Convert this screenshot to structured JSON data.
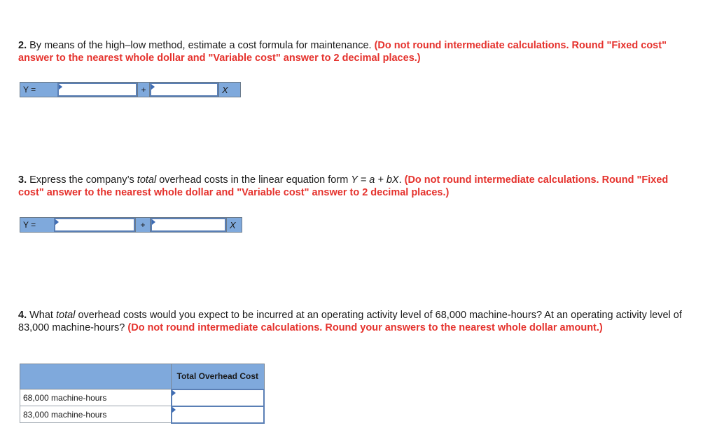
{
  "q2": {
    "number": "2.",
    "text": " By means of the high–low method, estimate a cost formula for maintenance. ",
    "instruction": "(Do not round intermediate calculations. Round \"Fixed cost\" answer to the nearest whole dollar and \"Variable cost\" answer to 2 decimal places.)",
    "equation": {
      "y_label": "Y =",
      "plus": "+",
      "x_label": "X",
      "fixed_value": "",
      "variable_value": ""
    }
  },
  "q3": {
    "number": "3.",
    "text_before": " Express the company’s ",
    "text_italic": "total",
    "text_after": " overhead costs in the linear equation form ",
    "formula": "Y = a + bX",
    "period": ". ",
    "instruction": "(Do not round intermediate calculations. Round \"Fixed cost\" answer to the nearest whole dollar and \"Variable cost\" answer to 2 decimal places.)",
    "equation": {
      "y_label": "Y =",
      "plus": "+",
      "x_label": "X",
      "fixed_value": "",
      "variable_value": ""
    }
  },
  "q4": {
    "number": "4.",
    "text_before": " What ",
    "text_italic": "total",
    "text_after": " overhead costs would you expect to be incurred at an operating activity level of 68,000 machine-hours? At an operating activity level of 83,000 machine-hours? ",
    "instruction": "(Do not round intermediate calculations. Round your answers to the nearest whole dollar amount.)",
    "table": {
      "column_header": "Total Overhead Cost",
      "rows": [
        {
          "label": "68,000 machine-hours",
          "value": ""
        },
        {
          "label": "83,000 machine-hours",
          "value": ""
        }
      ]
    }
  }
}
